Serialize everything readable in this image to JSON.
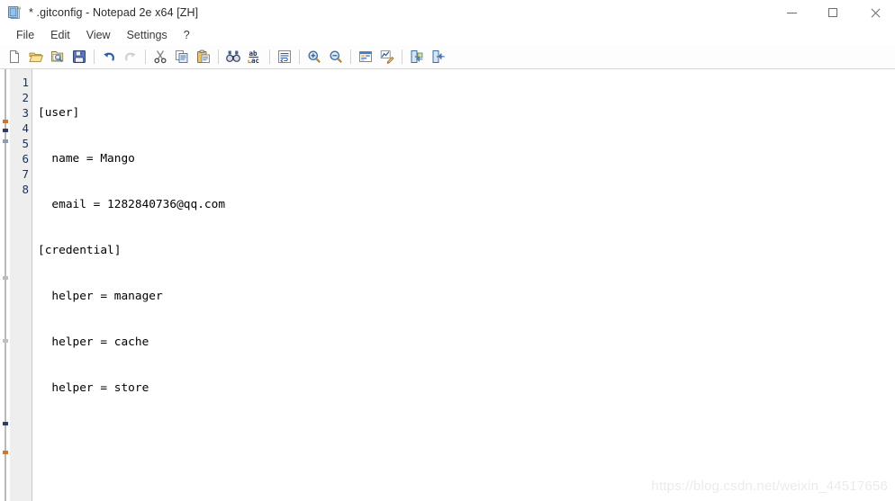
{
  "window": {
    "title": "* .gitconfig - Notepad 2e x64 [ZH]",
    "icon": "notepad-document-icon",
    "controls": {
      "minimize": "Minimize",
      "maximize": "Maximize",
      "close": "Close"
    }
  },
  "menubar": {
    "items": [
      {
        "label": "File"
      },
      {
        "label": "Edit"
      },
      {
        "label": "View"
      },
      {
        "label": "Settings"
      },
      {
        "label": "?"
      }
    ]
  },
  "toolbar": {
    "groups": [
      {
        "buttons": [
          {
            "name": "new-file-icon",
            "title": "New"
          },
          {
            "name": "open-file-icon",
            "title": "Open"
          },
          {
            "name": "browse-file-icon",
            "title": "Open in browser / Find file"
          },
          {
            "name": "save-file-icon",
            "title": "Save"
          }
        ]
      },
      {
        "buttons": [
          {
            "name": "undo-icon",
            "title": "Undo"
          },
          {
            "name": "redo-icon",
            "title": "Redo",
            "disabled": true
          }
        ]
      },
      {
        "buttons": [
          {
            "name": "cut-icon",
            "title": "Cut"
          },
          {
            "name": "copy-icon",
            "title": "Copy"
          },
          {
            "name": "paste-icon",
            "title": "Paste"
          }
        ]
      },
      {
        "buttons": [
          {
            "name": "find-icon",
            "title": "Find"
          },
          {
            "name": "replace-icon",
            "title": "Replace"
          }
        ]
      },
      {
        "buttons": [
          {
            "name": "word-wrap-icon",
            "title": "Word Wrap"
          }
        ]
      },
      {
        "buttons": [
          {
            "name": "zoom-in-icon",
            "title": "Zoom In"
          },
          {
            "name": "zoom-out-icon",
            "title": "Zoom Out"
          }
        ]
      },
      {
        "buttons": [
          {
            "name": "scheme-icon",
            "title": "Scheme Settings"
          },
          {
            "name": "customize-icon",
            "title": "Customize Schemes"
          }
        ]
      },
      {
        "buttons": [
          {
            "name": "exit-save-icon",
            "title": "Exit and Save"
          },
          {
            "name": "exit-icon",
            "title": "Exit"
          }
        ]
      }
    ]
  },
  "editor": {
    "line_numbers": [
      "1",
      "2",
      "3",
      "4",
      "5",
      "6",
      "7",
      "8"
    ],
    "lines": [
      "[user]",
      "  name = Mango",
      "  email = 1282840736@qq.com",
      "[credential]",
      "  helper = manager",
      "  helper = cache",
      "  helper = store",
      ""
    ],
    "colors": {
      "gutter_background": "#eeeeee",
      "gutter_text": "#1b3055",
      "code_background": "#ffffff",
      "code_text": "#000000"
    }
  },
  "watermark": {
    "text": "https://blog.csdn.net/weixin_44517656"
  }
}
